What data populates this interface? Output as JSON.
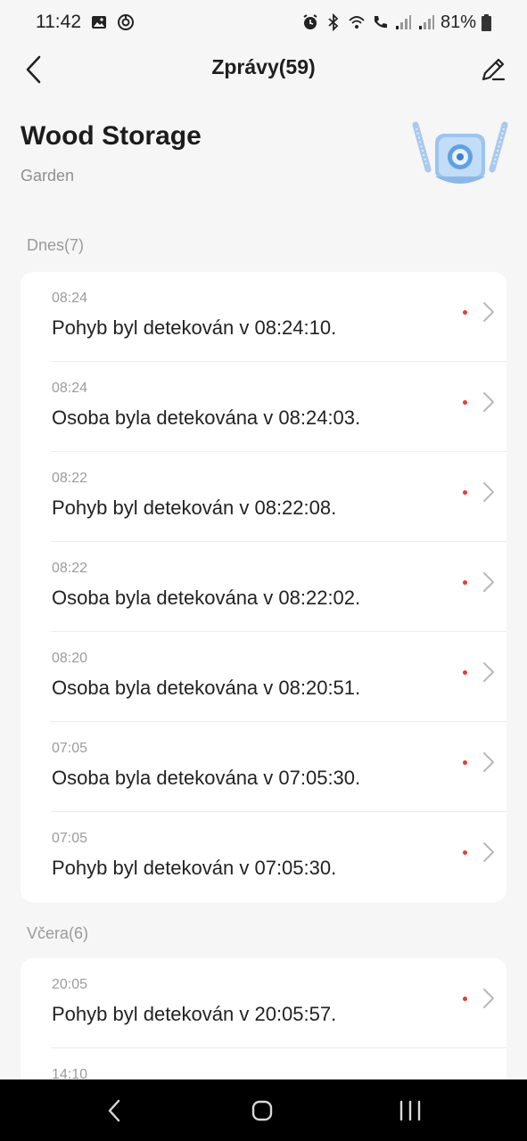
{
  "status_bar": {
    "time": "11:42",
    "battery": "81%",
    "icons": [
      "gallery-icon",
      "sync-icon",
      "alarm-icon",
      "bluetooth-icon",
      "wifi-icon",
      "call-icon",
      "signal-icon",
      "battery-icon"
    ]
  },
  "nav": {
    "title": "Zprávy(59)",
    "back_icon": "chevron-left-icon",
    "edit_icon": "pencil-icon"
  },
  "device": {
    "name": "Wood Storage",
    "room": "Garden"
  },
  "sections": [
    {
      "header": "Dnes(7)",
      "messages": [
        {
          "time": "08:24",
          "text": "Pohyb byl detekován v 08:24:10."
        },
        {
          "time": "08:24",
          "text": "Osoba byla detekována v 08:24:03."
        },
        {
          "time": "08:22",
          "text": "Pohyb byl detekován v 08:22:08."
        },
        {
          "time": "08:22",
          "text": "Osoba byla detekována v 08:22:02."
        },
        {
          "time": "08:20",
          "text": "Osoba byla detekována v 08:20:51."
        },
        {
          "time": "07:05",
          "text": "Osoba byla detekována v 07:05:30."
        },
        {
          "time": "07:05",
          "text": "Pohyb byl detekován v 07:05:30."
        }
      ]
    },
    {
      "header": "Včera(6)",
      "messages": [
        {
          "time": "20:05",
          "text": "Pohyb byl detekován v 20:05:57."
        },
        {
          "time": "14:10",
          "text": ""
        }
      ]
    }
  ],
  "colors": {
    "background": "#f6f6f6",
    "card": "#ffffff",
    "unread_dot": "#e83a3a",
    "muted_text": "#9c9c9c",
    "nav_bar": "#000000"
  }
}
